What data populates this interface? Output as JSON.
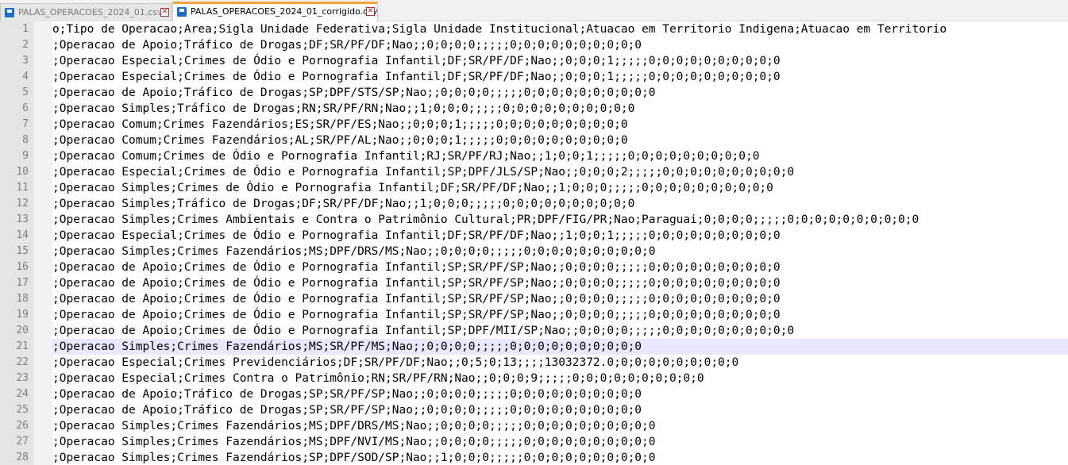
{
  "tabs": [
    {
      "label": "PALAS_OPERACOES_2024_01.csv",
      "active": false,
      "close_glyph": "✕"
    },
    {
      "label": "PALAS_OPERACOES_2024_01_corrigido.csv",
      "active": true,
      "close_glyph": "✕"
    }
  ],
  "icons": {
    "file": "file-icon",
    "close": "close-icon"
  },
  "colors": {
    "active_tab_accent": "#f2a43a",
    "current_line": "#e8e8ff",
    "gutter_bg": "#e4e4e4",
    "gutter_text": "#808080",
    "close_red": "#b03030"
  },
  "editor": {
    "current_line": 21,
    "lines": [
      {
        "num": "1",
        "text": "o;Tipo de Operacao;Area;Sigla Unidade Federativa;Sigla Unidade Institucional;Atuacao em Territorio Indigena;Atuacao em Territorio"
      },
      {
        "num": "2",
        "text": ";Operacao de Apoio;Tráfico de Drogas;DF;SR/PF/DF;Nao;;0;0;0;0;;;;;0;0;0;0;0;0;0;0;0;0"
      },
      {
        "num": "3",
        "text": ";Operacao Especial;Crimes de Ódio e Pornografia Infantil;DF;SR/PF/DF;Nao;;0;0;0;1;;;;;0;0;0;0;0;0;0;0;0;0"
      },
      {
        "num": "4",
        "text": ";Operacao Especial;Crimes de Ódio e Pornografia Infantil;DF;SR/PF/DF;Nao;;0;0;0;1;;;;;0;0;0;0;0;0;0;0;0;0"
      },
      {
        "num": "5",
        "text": ";Operacao de Apoio;Tráfico de Drogas;SP;DPF/STS/SP;Nao;;0;0;0;0;;;;;0;0;0;0;0;0;0;0;0;0"
      },
      {
        "num": "6",
        "text": ";Operacao Simples;Tráfico de Drogas;RN;SR/PF/RN;Nao;;1;0;0;0;;;;;0;0;0;0;0;0;0;0;0;0"
      },
      {
        "num": "7",
        "text": ";Operacao Comum;Crimes Fazendários;ES;SR/PF/ES;Nao;;0;0;0;1;;;;;0;0;0;0;0;0;0;0;0;0"
      },
      {
        "num": "8",
        "text": ";Operacao Comum;Crimes Fazendários;AL;SR/PF/AL;Nao;;0;0;0;1;;;;;0;0;0;0;0;0;0;0;0;0"
      },
      {
        "num": "9",
        "text": ";Operacao Comum;Crimes de Ódio e Pornografia Infantil;RJ;SR/PF/RJ;Nao;;1;0;0;1;;;;;0;0;0;0;0;0;0;0;0;0"
      },
      {
        "num": "10",
        "text": ";Operacao Especial;Crimes de Ódio e Pornografia Infantil;SP;DPF/JLS/SP;Nao;;0;0;0;2;;;;;0;0;0;0;0;0;0;0;0;0"
      },
      {
        "num": "11",
        "text": ";Operacao Simples;Crimes de Ódio e Pornografia Infantil;DF;SR/PF/DF;Nao;;1;0;0;0;;;;;0;0;0;0;0;0;0;0;0;0"
      },
      {
        "num": "12",
        "text": ";Operacao Simples;Tráfico de Drogas;DF;SR/PF/DF;Nao;;1;0;0;0;;;;;0;0;0;0;0;0;0;0;0;0"
      },
      {
        "num": "13",
        "text": ";Operacao Simples;Crimes Ambientais e Contra o Patrimônio Cultural;PR;DPF/FIG/PR;Nao;Paraguai;0;0;0;0;;;;;0;0;0;0;0;0;0;0;0;0"
      },
      {
        "num": "14",
        "text": ";Operacao Especial;Crimes de Ódio e Pornografia Infantil;DF;SR/PF/DF;Nao;;1;0;0;1;;;;;0;0;0;0;0;0;0;0;0;0"
      },
      {
        "num": "15",
        "text": ";Operacao Simples;Crimes Fazendários;MS;DPF/DRS/MS;Nao;;0;0;0;0;;;;;0;0;0;0;0;0;0;0;0;0"
      },
      {
        "num": "16",
        "text": ";Operacao de Apoio;Crimes de Ódio e Pornografia Infantil;SP;SR/PF/SP;Nao;;0;0;0;0;;;;;0;0;0;0;0;0;0;0;0;0"
      },
      {
        "num": "17",
        "text": ";Operacao de Apoio;Crimes de Ódio e Pornografia Infantil;SP;SR/PF/SP;Nao;;0;0;0;0;;;;;0;0;0;0;0;0;0;0;0;0"
      },
      {
        "num": "18",
        "text": ";Operacao de Apoio;Crimes de Ódio e Pornografia Infantil;SP;SR/PF/SP;Nao;;0;0;0;0;;;;;0;0;0;0;0;0;0;0;0;0"
      },
      {
        "num": "19",
        "text": ";Operacao de Apoio;Crimes de Ódio e Pornografia Infantil;SP;SR/PF/SP;Nao;;0;0;0;0;;;;;0;0;0;0;0;0;0;0;0;0"
      },
      {
        "num": "20",
        "text": ";Operacao de Apoio;Crimes de Ódio e Pornografia Infantil;SP;DPF/MII/SP;Nao;;0;0;0;0;;;;;0;0;0;0;0;0;0;0;0;0"
      },
      {
        "num": "21",
        "text": ";Operacao Simples;Crimes Fazendários;MS;SR/PF/MS;Nao;;0;0;0;0;;;;;0;0;0;0;0;0;0;0;0;0"
      },
      {
        "num": "22",
        "text": ";Operacao Especial;Crimes Previdenciários;DF;SR/PF/DF;Nao;;0;5;0;13;;;;13032372.0;0;0;0;0;0;0;0;0;0"
      },
      {
        "num": "23",
        "text": ";Operacao Especial;Crimes Contra o Patrimônio;RN;SR/PF/RN;Nao;;0;0;0;9;;;;;0;0;0;0;0;0;0;0;0;0"
      },
      {
        "num": "24",
        "text": ";Operacao de Apoio;Tráfico de Drogas;SP;SR/PF/SP;Nao;;0;0;0;0;;;;;0;0;0;0;0;0;0;0;0;0"
      },
      {
        "num": "25",
        "text": ";Operacao de Apoio;Tráfico de Drogas;SP;SR/PF/SP;Nao;;0;0;0;0;;;;;0;0;0;0;0;0;0;0;0;0"
      },
      {
        "num": "26",
        "text": ";Operacao Simples;Crimes Fazendários;MS;DPF/DRS/MS;Nao;;0;0;0;0;;;;;0;0;0;0;0;0;0;0;0;0"
      },
      {
        "num": "27",
        "text": ";Operacao Simples;Crimes Fazendários;MS;DPF/NVI/MS;Nao;;0;0;0;0;;;;;0;0;0;0;0;0;0;0;0;0"
      },
      {
        "num": "28",
        "text": ";Operacao Simples;Crimes Fazendários;SP;DPF/SOD/SP;Nao;;1;0;0;0;;;;;0;0;0;0;0;0;0;0;0;0"
      }
    ]
  }
}
